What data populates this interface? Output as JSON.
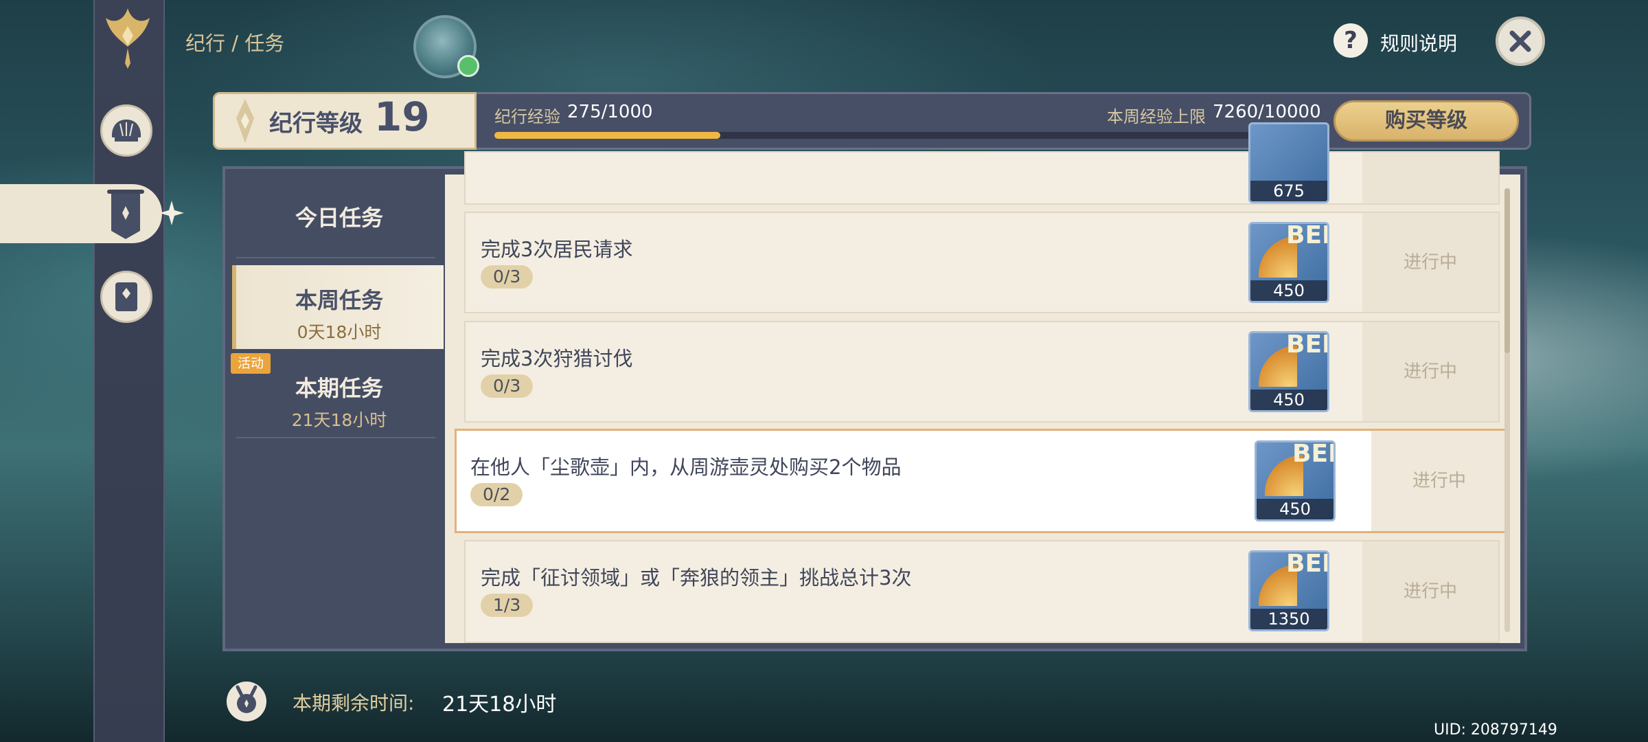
{
  "header": {
    "breadcrumb": "纪行 / 任务",
    "rules_label": "规则说明"
  },
  "level": {
    "label": "纪行等级",
    "value": "19",
    "exp_label": "纪行经验",
    "exp_value": "275/1000",
    "exp_progress": 0.275,
    "weekly_cap_label": "本周经验上限",
    "weekly_cap_value": "7260/10000",
    "buy_label": "购买等级"
  },
  "tabs": {
    "today": {
      "label": "今日任务"
    },
    "week": {
      "label": "本周任务",
      "sub": "0天18小时"
    },
    "period": {
      "label": "本期任务",
      "sub": "21天18小时",
      "tag": "活动"
    }
  },
  "tasks": [
    {
      "title": "",
      "progress": "",
      "reward": "675",
      "status": ""
    },
    {
      "title": "完成3次居民请求",
      "progress": "0/3",
      "reward": "450",
      "status": "进行中"
    },
    {
      "title": "完成3次狩猎讨伐",
      "progress": "0/3",
      "reward": "450",
      "status": "进行中"
    },
    {
      "title": "在他人「尘歌壶」内，从周游壶灵处购买2个物品",
      "progress": "0/2",
      "reward": "450",
      "status": "进行中"
    },
    {
      "title": "完成「征讨领域」或「奔狼的领主」挑战总计3次",
      "progress": "1/3",
      "reward": "1350",
      "status": "进行中"
    }
  ],
  "reward_icon": {
    "letters": "BEP",
    "icon": "battle-pass-exp-icon"
  },
  "footer": {
    "remaining_label": "本期剩余时间:",
    "remaining_value": "21天18小时",
    "uid": "UID: 208797149"
  },
  "colors": {
    "accent_gold": "#d8b36b",
    "panel": "#454d63",
    "progress_fill": "#f0b742"
  }
}
